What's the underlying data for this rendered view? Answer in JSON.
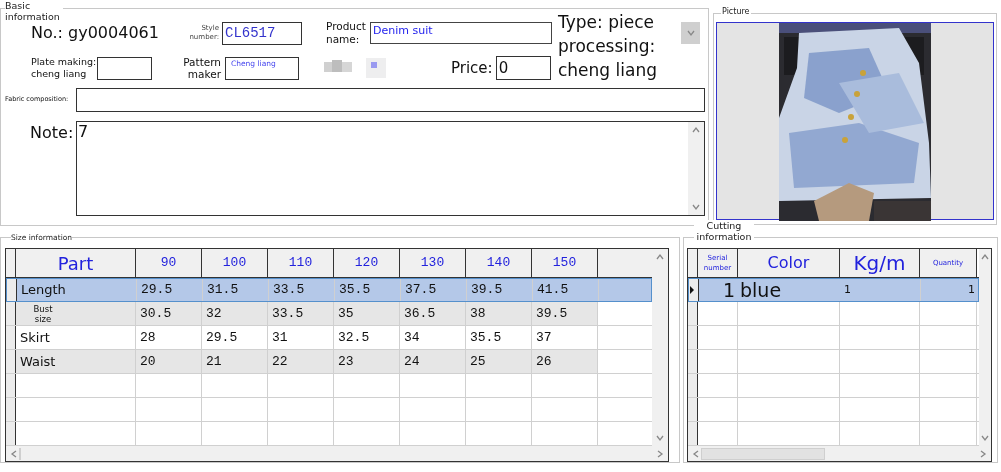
{
  "basic_info": {
    "title": "Basic information",
    "number": "No.: gy0004061",
    "style_number": {
      "label": "Style number:",
      "value": "CL6517"
    },
    "product_name": {
      "label": "Product name:",
      "value": "Denim suit"
    },
    "type_label": "Type: piece processing: cheng liang",
    "plate_making": {
      "label": "Plate making: cheng liang"
    },
    "pattern_maker": {
      "label": "Pattern maker",
      "value": "Cheng liang"
    },
    "price": {
      "label": "Price:",
      "value": "0"
    },
    "fabric_composition": {
      "label": "Fabric composition:"
    },
    "note": {
      "label": "Note:",
      "value": "7"
    }
  },
  "picture": {
    "title": "Picture"
  },
  "size_info": {
    "title": "Size information",
    "columns": [
      "Part",
      "90",
      "100",
      "110",
      "120",
      "130",
      "140",
      "150"
    ],
    "rows": [
      {
        "cells": [
          "Length",
          "29.5",
          "31.5",
          "33.5",
          "35.5",
          "37.5",
          "39.5",
          "41.5"
        ],
        "selected": true
      },
      {
        "cells": [
          "Bust size",
          "30.5",
          "32",
          "33.5",
          "35",
          "36.5",
          "38",
          "39.5"
        ],
        "selected": false
      },
      {
        "cells": [
          "Skirt",
          "28",
          "29.5",
          "31",
          "32.5",
          "34",
          "35.5",
          "37"
        ],
        "selected": false
      },
      {
        "cells": [
          "Waist",
          "20",
          "21",
          "22",
          "23",
          "24",
          "25",
          "26"
        ],
        "selected": false
      }
    ]
  },
  "cutting_info": {
    "title": "Cutting information",
    "columns": [
      "Serial number",
      "Color",
      "Kg/m",
      "Quantity"
    ],
    "rows": [
      {
        "cells": [
          "1",
          "blue",
          "1",
          "1"
        ],
        "selected": true
      }
    ]
  }
}
